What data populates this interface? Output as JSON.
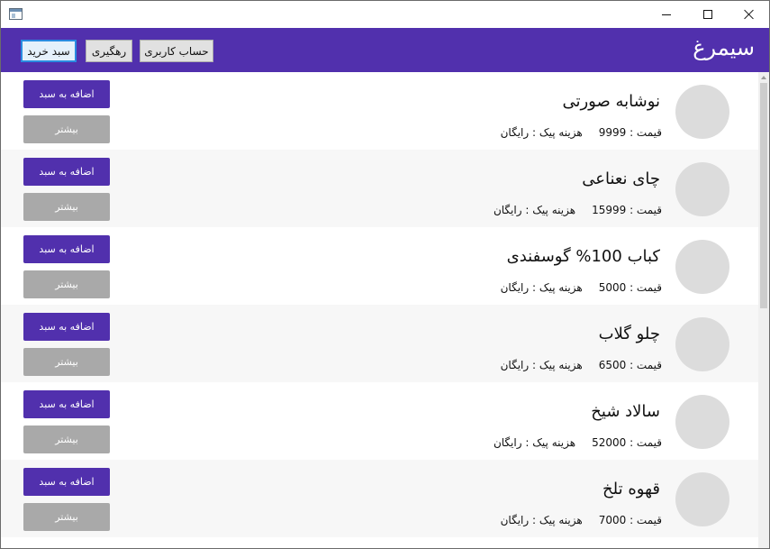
{
  "window": {
    "controls": [
      "minimize-icon",
      "maximize-icon",
      "close-icon"
    ]
  },
  "header": {
    "brand": "سیمرغ",
    "cart_label": "سبد خرید",
    "track_label": "رهگیری",
    "account_label": "حساب کاربری",
    "accent_color": "#5130ad"
  },
  "products": [
    {
      "name": "نوشابه صورتی",
      "price_label": "قیمت : 9999",
      "delivery_label": "هزینه پیک : رایگان",
      "add_label": "اضافه به سبد",
      "more_label": "بیشتر"
    },
    {
      "name": "چای نعناعی",
      "price_label": "قیمت : 15999",
      "delivery_label": "هزینه پیک : رایگان",
      "add_label": "اضافه به سبد",
      "more_label": "بیشتر"
    },
    {
      "name": "کباب 100% گوسفندی",
      "price_label": "قیمت : 5000",
      "delivery_label": "هزینه پیک : رایگان",
      "add_label": "اضافه به سبد",
      "more_label": "بیشتر"
    },
    {
      "name": "چلو گلاب",
      "price_label": "قیمت : 6500",
      "delivery_label": "هزینه پیک : رایگان",
      "add_label": "اضافه به سبد",
      "more_label": "بیشتر"
    },
    {
      "name": "سالاد شیخ",
      "price_label": "قیمت : 52000",
      "delivery_label": "هزینه پیک : رایگان",
      "add_label": "اضافه به سبد",
      "more_label": "بیشتر"
    },
    {
      "name": "قهوه تلخ",
      "price_label": "قیمت : 7000",
      "delivery_label": "هزینه پیک : رایگان",
      "add_label": "اضافه به سبد",
      "more_label": "بیشتر"
    }
  ]
}
